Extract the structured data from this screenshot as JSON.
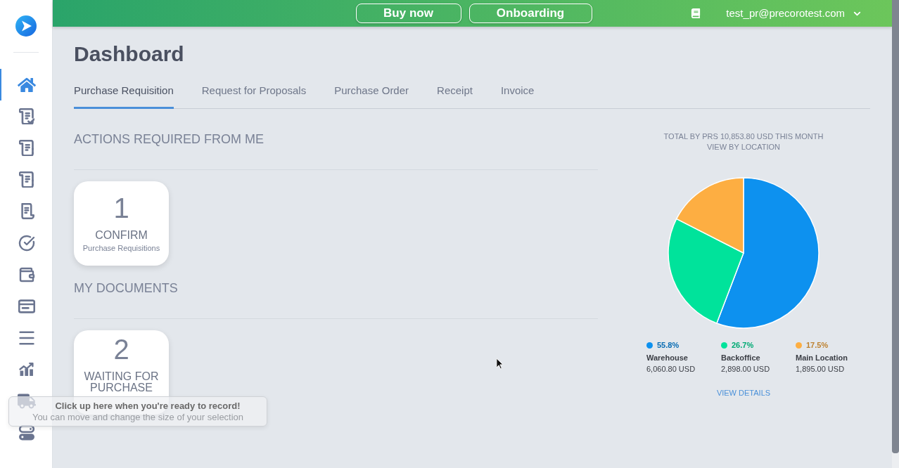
{
  "sidebar": {
    "items": [
      {
        "selected": true
      },
      {
        "selected": false
      },
      {
        "selected": false
      },
      {
        "selected": false
      },
      {
        "selected": false
      },
      {
        "selected": false
      },
      {
        "selected": false
      },
      {
        "selected": false
      },
      {
        "selected": false
      },
      {
        "selected": false
      },
      {
        "selected": false
      },
      {
        "selected": false
      }
    ]
  },
  "topbar": {
    "buttons": [
      "Buy now",
      "Onboarding"
    ],
    "user_email": "test_pr@precorotest.com"
  },
  "page_title": "Dashboard",
  "tabs": [
    {
      "label": "Purchase Requisition",
      "selected": true
    },
    {
      "label": "Request for Proposals",
      "selected": false
    },
    {
      "label": "Purchase Order",
      "selected": false
    },
    {
      "label": "Receipt",
      "selected": false
    },
    {
      "label": "Invoice",
      "selected": false
    }
  ],
  "sections": [
    {
      "title": "ACTIONS REQUIRED FROM ME",
      "cards": [
        {
          "count": "1",
          "label": "CONFIRM",
          "sublabel": "Purchase Requisitions"
        }
      ]
    },
    {
      "title": "MY DOCUMENTS",
      "cards": [
        {
          "count": "2",
          "label": "WAITING FOR PURCHASE"
        }
      ]
    }
  ],
  "location_chart": {
    "chart_data": {
      "type": "pie",
      "title": "TOTAL BY PRS 10,853.80 USD THIS MONTH",
      "categories": [
        "Warehouse",
        "Backoffice",
        "Main Location"
      ],
      "values": [
        55.8,
        26.7,
        17.5
      ]
    },
    "subtitle": "VIEW BY LOCATION",
    "legend": [
      {
        "percent": "55.8%",
        "amount": "6,060.80 USD",
        "color": "#0d91ef"
      },
      {
        "percent": "26.7%",
        "amount": "2,898.00 USD",
        "color": "#00e39b"
      },
      {
        "percent": "17.5%",
        "amount": "1,895.00 USD",
        "color": "#fdae42"
      }
    ],
    "link": "VIEW DETAILS"
  },
  "recorder_prompt": {
    "title": "Click up here when you're ready to record!",
    "hint": "You can move and change the size of your selection"
  }
}
